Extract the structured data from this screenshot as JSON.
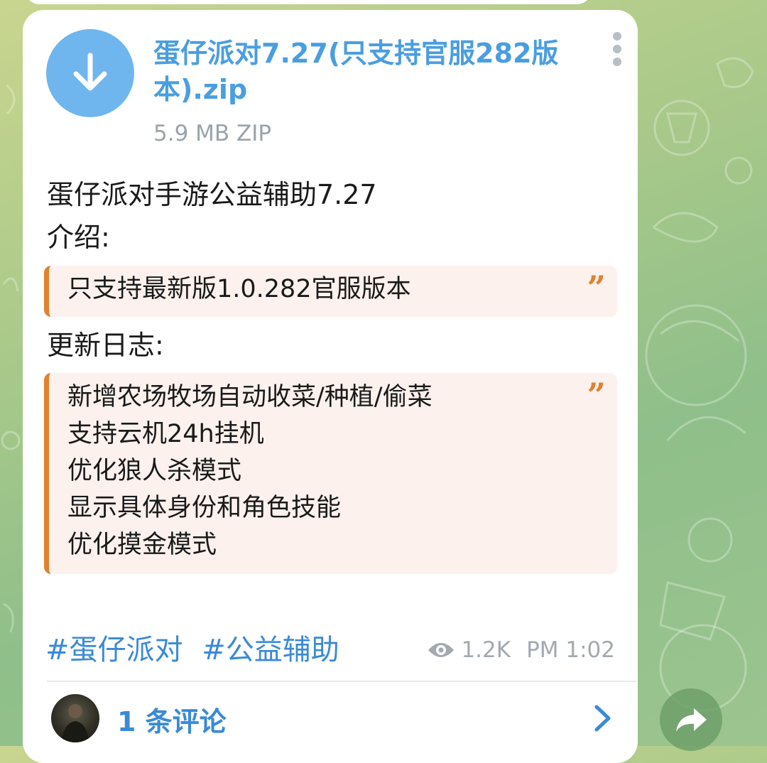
{
  "message": {
    "file": {
      "name": "蛋仔派对7.27(只支持官服282版本).zip",
      "meta": "5.9 MB ZIP"
    },
    "title_line": "蛋仔派对手游公益辅助7.27",
    "intro_label": "介绍:",
    "intro_quote": [
      "只支持最新版1.0.282官服版本"
    ],
    "changelog_label": "更新日志:",
    "changelog_quote": [
      "新增农场牧场自动收菜/种植/偷菜",
      "支持云机24h挂机",
      "优化狼人杀模式",
      "显示具体身份和角色技能",
      "优化摸金模式"
    ],
    "quote_mark": "”",
    "hashtags": [
      "#蛋仔派对",
      "#公益辅助"
    ],
    "views": "1.2K",
    "time": "PM 1:02",
    "comments_label": "1 条评论"
  },
  "colors": {
    "accent_blue": "#3a8ad6",
    "file_icon_blue": "#6fb6ef",
    "quote_bar": "#e0822e",
    "quote_bg": "#fdf1ed"
  },
  "icons": [
    "download-icon",
    "more-vertical-icon",
    "eye-icon",
    "chevron-right-icon",
    "share-arrow-icon"
  ]
}
